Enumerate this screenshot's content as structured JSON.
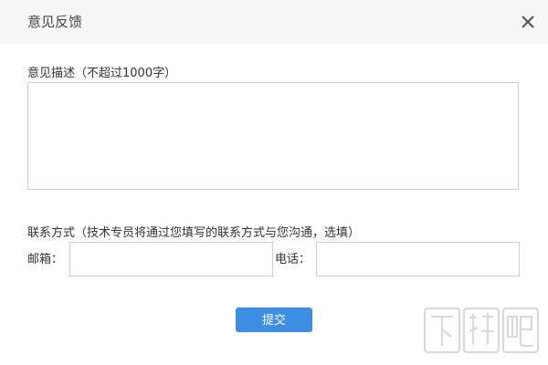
{
  "dialog": {
    "title": "意见反馈",
    "close_icon": "close-icon"
  },
  "description": {
    "label": "意见描述（不超过1000字）",
    "value": ""
  },
  "contact": {
    "label": "联系方式（技术专员将通过您填写的联系方式与您沟通，选填）",
    "email_label": "邮箱：",
    "email_value": "",
    "phone_label": "电话：",
    "phone_value": ""
  },
  "actions": {
    "submit_label": "提交"
  },
  "watermark": {
    "text": "下载吧",
    "icon": "watermark-logo"
  },
  "colors": {
    "titlebar_bg": "#f7f7f7",
    "primary_button": "#3d8fe3",
    "border": "#cfcfcf"
  }
}
